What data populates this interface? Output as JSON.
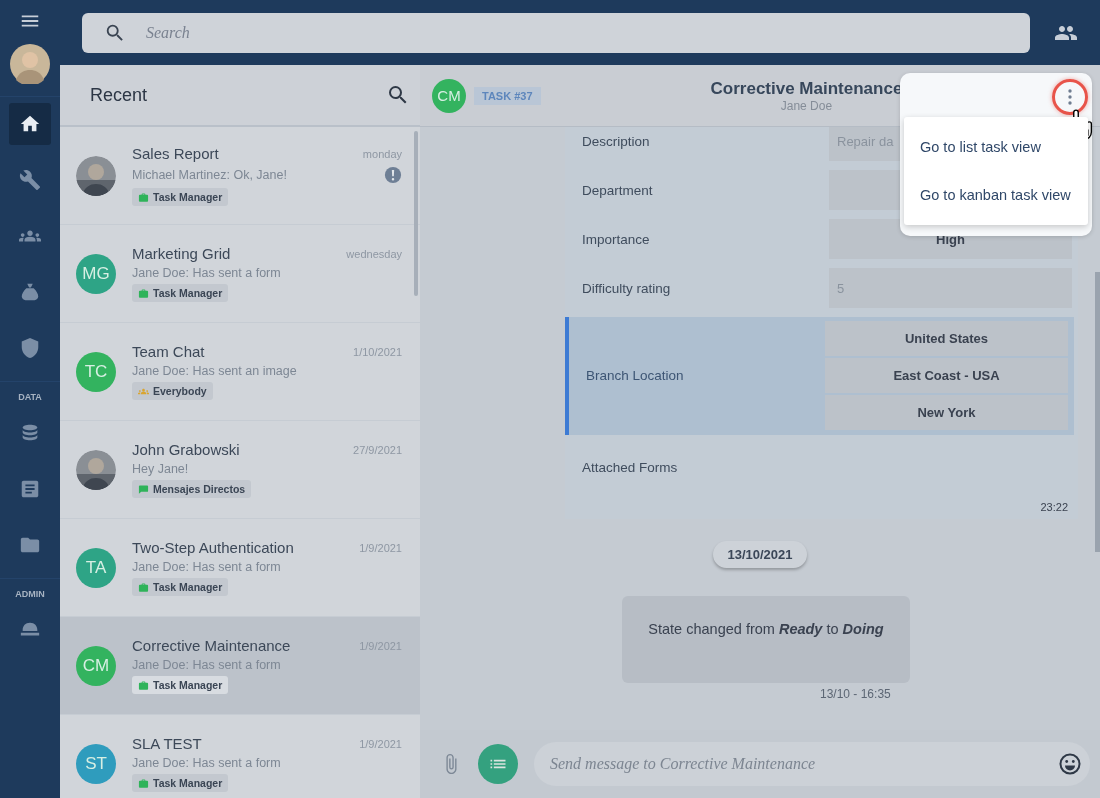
{
  "rail": {
    "items": [
      {
        "selected": true
      },
      {
        "selected": false
      },
      {
        "selected": false
      },
      {
        "selected": false
      },
      {
        "selected": false
      }
    ],
    "sections": [
      {
        "label": "DATA",
        "items": [
          {
            "selected": false
          },
          {
            "selected": false
          },
          {
            "selected": false
          }
        ]
      },
      {
        "label": "ADMIN",
        "items": [
          {
            "selected": false
          }
        ]
      }
    ]
  },
  "search": {
    "placeholder": "Search"
  },
  "recent": {
    "title": "Recent",
    "rows": [
      {
        "name": "Sales Report",
        "preview": "Michael Martinez: Ok, Jane!",
        "time": "monday",
        "tag": {
          "label": "Task Manager",
          "kind": "task",
          "color": "#2fb35a"
        },
        "alert": true,
        "selected": false
      },
      {
        "name": "Marketing Grid",
        "preview": "Jane Doe: Has sent a form",
        "time": "wednesday",
        "avatar": {
          "kind": "initials",
          "initials": "MG",
          "color": "#2ea486"
        },
        "tag": {
          "label": "Task Manager",
          "kind": "task",
          "color": "#2fb35a"
        },
        "alert": false,
        "selected": false
      },
      {
        "name": "Team Chat",
        "preview": "Jane Doe: Has sent an image",
        "time": "1/10/2021",
        "avatar": {
          "kind": "initials",
          "initials": "TC",
          "color": "#33b35f"
        },
        "tag": {
          "label": "Everybody",
          "kind": "everybody",
          "color": "#d9a531"
        },
        "alert": false,
        "selected": false
      },
      {
        "name": "John Grabowski",
        "preview": "Hey Jane!",
        "time": "27/9/2021",
        "tag": {
          "label": "Mensajes Directos",
          "kind": "direct",
          "color": "#2fb35a"
        },
        "alert": false,
        "selected": false
      },
      {
        "name": "Two-Step Authentication",
        "preview": "Jane Doe: Has sent a form",
        "time": "1/9/2021",
        "avatar": {
          "kind": "initials",
          "initials": "TA",
          "color": "#2ea486"
        },
        "tag": {
          "label": "Task Manager",
          "kind": "task",
          "color": "#2fb35a"
        },
        "alert": false,
        "selected": false
      },
      {
        "name": "Corrective Maintenance",
        "preview": "Jane Doe: Has sent a form",
        "time": "1/9/2021",
        "avatar": {
          "kind": "initials",
          "initials": "CM",
          "color": "#33b35f"
        },
        "tag": {
          "label": "Task Manager",
          "kind": "task",
          "color": "#2fb35a"
        },
        "alert": false,
        "selected": true
      },
      {
        "name": "SLA TEST",
        "preview": "Jane Doe: Has sent a form",
        "time": "1/9/2021",
        "avatar": {
          "kind": "initials",
          "initials": "ST",
          "color": "#2f9cbd"
        },
        "tag": {
          "label": "Task Manager",
          "kind": "task",
          "color": "#2fb35a"
        },
        "alert": false,
        "selected": false
      }
    ]
  },
  "chat": {
    "avatar": {
      "initials": "CM",
      "color": "#33b35f"
    },
    "task": "TASK #37",
    "title": "Corrective Maintenance",
    "subtitle": "Jane Doe",
    "form": {
      "fields": [
        {
          "label": "Description",
          "kind": "text",
          "values": [
            "Repair da"
          ],
          "highlighted": false
        },
        {
          "label": "Department",
          "kind": "select",
          "highlighted": false
        },
        {
          "label": "Importance",
          "kind": "select",
          "values": [
            "High"
          ],
          "highlighted": false
        },
        {
          "label": "Difficulty rating",
          "kind": "text",
          "values": [
            "5"
          ],
          "highlighted": false
        },
        {
          "label": "Branch Location",
          "kind": "select",
          "values": [
            "United States",
            "East Coast - USA",
            "New York"
          ],
          "highlighted": true
        },
        {
          "label": "Attached Forms",
          "kind": "none",
          "highlighted": false
        }
      ],
      "time": "23:22"
    },
    "date_chip": "13/10/2021",
    "system_message": {
      "text": "State changed from *Ready* to *Doing*",
      "time": "13/10 - 16:35"
    },
    "composer": {
      "placeholder": "Send message to Corrective Maintenance"
    }
  },
  "menu": {
    "button_highlighted": true,
    "items": [
      "Go to list task view",
      "Go to kanban task view"
    ]
  }
}
